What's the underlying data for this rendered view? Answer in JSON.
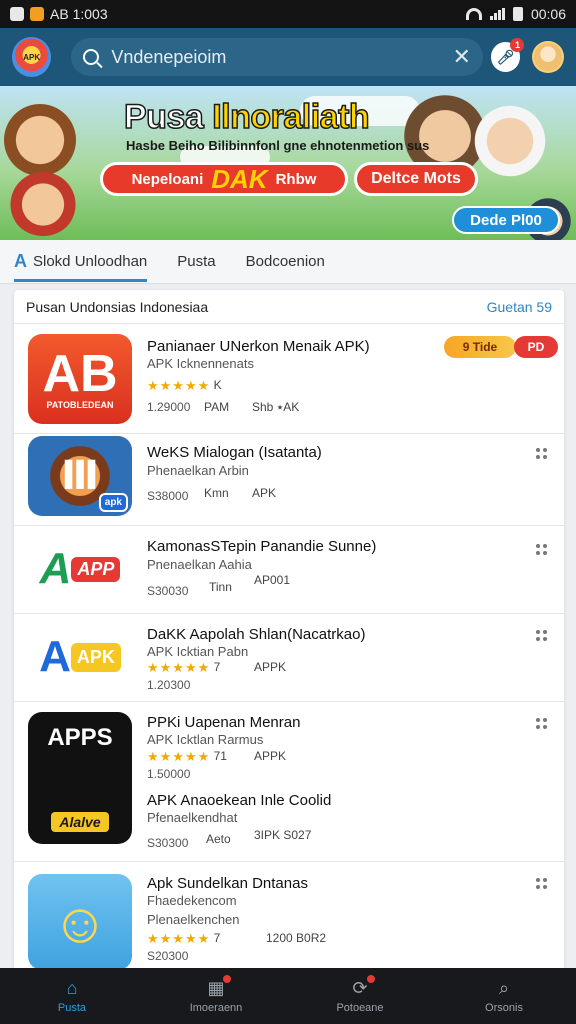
{
  "status_bar": {
    "left_text": "AB 1:003",
    "time": "00:06"
  },
  "header": {
    "logo_text": "APK",
    "search_value": "",
    "search_placeholder": "Vndenepeioim",
    "clear_icon": "close-icon",
    "voice_badge": "1"
  },
  "banner": {
    "title_a": "Pusa ",
    "title_b": "Ilnoraliath",
    "subtitle": "Hasbe Beiho Bilibinnfonl gne ehnotenmetion sus",
    "pill1_left": "Nepeloani",
    "pill1_big": "DAK",
    "pill1_right": "Rhbw",
    "pill2": "Deltce Mots",
    "cta": "Dede Pl00"
  },
  "tabs": [
    {
      "label": "Slokd Unloodhan"
    },
    {
      "label": "Pusta"
    },
    {
      "label": "Bodcoenion"
    }
  ],
  "section": {
    "title": "Pusan Undonsias Indonesiaa",
    "more": "Guetan 59"
  },
  "apps": [
    {
      "icon_text": "AB",
      "icon_subtext": "PATOBLEDEAN",
      "name": "Panianaer UNerkon Menaik APK)",
      "sub": "APK Icknennenats",
      "rating": "★★★★★",
      "rating_extra": "K",
      "size": "1.29000",
      "col2": "PAM",
      "col3": "Shb ٭AK",
      "tag1": "9 Tide",
      "tag2": "PD"
    },
    {
      "icon_text": "Ⅲ",
      "icon_badge": "apk",
      "name": "WeKS Mialogan (Isatanta)",
      "sub": "Phenaelkan Arbin",
      "rating": "",
      "rating_extra": "",
      "size": "S38000",
      "col2": "Kmn",
      "col3": "APK"
    },
    {
      "icon_text": "A APP",
      "name": "KamonasSTepin Panandie Sunne)",
      "sub": "Pnenaelkan Aahia",
      "rating": "",
      "rating_extra": "",
      "size": "S30030",
      "col2": "Tinn",
      "col3": "AP001"
    },
    {
      "icon_text": "A APK",
      "name": "DaKK Aapolah Shlan(Nacatrkao)",
      "sub": "APK Icktian Pabn",
      "rating": "★★★★★",
      "rating_extra": "7",
      "size": "1.20300",
      "col2": "",
      "col3": "APPK"
    },
    {
      "icon_text": "APPS",
      "icon_subtext": "Alalve",
      "name": "PPKi Uapenan Menran",
      "sub": "APK Icktlan Rarmus",
      "rating": "★★★★★",
      "rating_extra": "71",
      "size": "1.50000",
      "col2": "",
      "col3": "APPK",
      "name2": "APK Anaoekean Inle Coolid",
      "sub2": "Pfenaelkendhat",
      "size2": "S30300",
      "col2b": "Aeto",
      "col3b": "3IPK S027"
    },
    {
      "icon_text": "☺",
      "name": "Apk Sundelkan Dntanas",
      "sub": "Fhaedekencom",
      "sub_b": "Plenaelkenchen",
      "rating": "★★★★★",
      "rating_extra": "7",
      "size": "S20300",
      "col2": "",
      "col3": "1200 B0R2"
    }
  ],
  "bottom_nav": [
    {
      "label": "Pusta",
      "icon": "home-icon"
    },
    {
      "label": "Imoeraenn",
      "icon": "apps-icon"
    },
    {
      "label": "Potoeane",
      "icon": "updates-icon"
    },
    {
      "label": "Orsonis",
      "icon": "search-icon"
    }
  ],
  "colors": {
    "header": "#1d5678",
    "accent": "#2f86c8",
    "star": "#f2a900",
    "badge": "#e53935"
  }
}
